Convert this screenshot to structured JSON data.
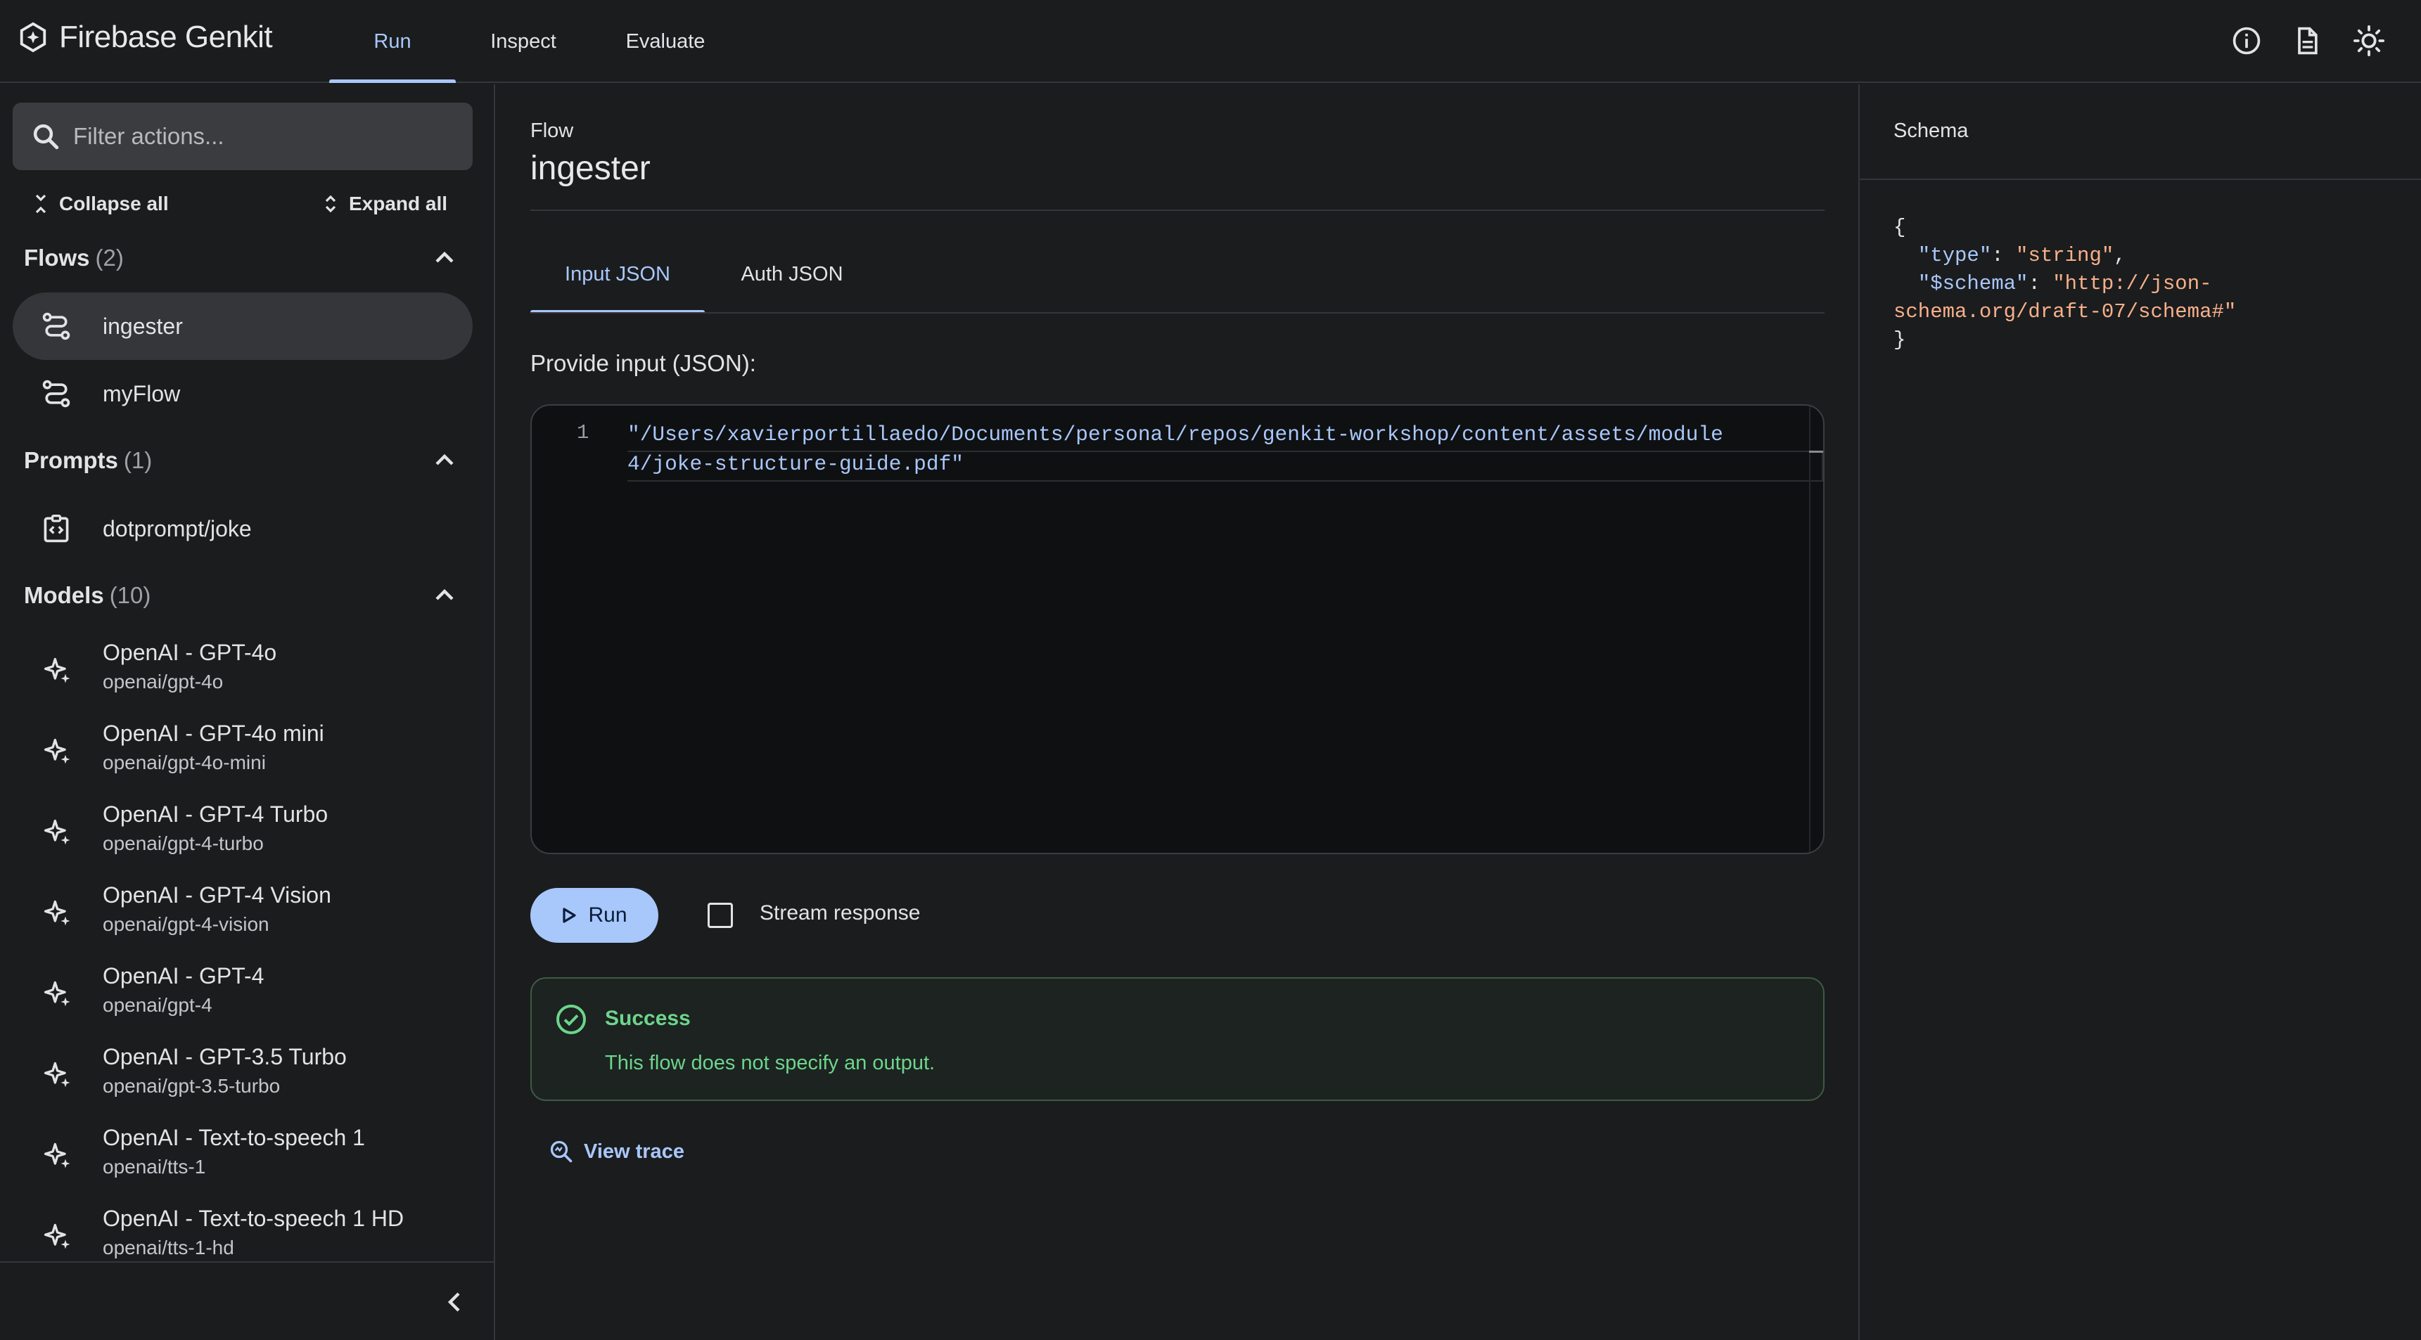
{
  "app": {
    "title": "Firebase Genkit"
  },
  "nav": {
    "tabs": [
      "Run",
      "Inspect",
      "Evaluate"
    ],
    "active": "Run"
  },
  "topIcons": [
    "info-icon",
    "docs-icon",
    "theme-icon"
  ],
  "sidebar": {
    "search_placeholder": "Filter actions...",
    "collapse_all": "Collapse all",
    "expand_all": "Expand all",
    "sections": {
      "flows": {
        "label": "Flows",
        "count": "(2)",
        "items": [
          "ingester",
          "myFlow"
        ]
      },
      "prompts": {
        "label": "Prompts",
        "count": "(1)",
        "items": [
          "dotprompt/joke"
        ]
      },
      "models": {
        "label": "Models",
        "count": "(10)",
        "items": [
          {
            "name": "OpenAI - GPT-4o",
            "id": "openai/gpt-4o"
          },
          {
            "name": "OpenAI - GPT-4o mini",
            "id": "openai/gpt-4o-mini"
          },
          {
            "name": "OpenAI - GPT-4 Turbo",
            "id": "openai/gpt-4-turbo"
          },
          {
            "name": "OpenAI - GPT-4 Vision",
            "id": "openai/gpt-4-vision"
          },
          {
            "name": "OpenAI - GPT-4",
            "id": "openai/gpt-4"
          },
          {
            "name": "OpenAI - GPT-3.5 Turbo",
            "id": "openai/gpt-3.5-turbo"
          },
          {
            "name": "OpenAI - Text-to-speech 1",
            "id": "openai/tts-1"
          },
          {
            "name": "OpenAI - Text-to-speech 1 HD",
            "id": "openai/tts-1-hd"
          }
        ]
      }
    },
    "selected": "ingester"
  },
  "main": {
    "kind": "Flow",
    "title": "ingester",
    "tabs": [
      "Input JSON",
      "Auth JSON"
    ],
    "active_tab": "Input JSON",
    "provide_label": "Provide input (JSON):",
    "editor": {
      "line_number": "1",
      "code": "\"/Users/xavierportillaedo/Documents/personal/repos/genkit-workshop/content/assets/module4/joke-structure-guide.pdf\""
    },
    "run_label": "Run",
    "stream_label": "Stream response",
    "stream_checked": false,
    "result": {
      "status": "Success",
      "message": "This flow does not specify an output."
    },
    "view_trace": "View trace"
  },
  "schema": {
    "title": "Schema",
    "open": "{",
    "type_key": "\"type\"",
    "type_value": "\"string\"",
    "schema_key": "\"$schema\"",
    "schema_value_1": "\"http://json-",
    "schema_value_2": "schema.org/draft-07/schema#\"",
    "close": "}"
  },
  "colors": {
    "accent": "#a8c7fa",
    "success": "#6dd58c",
    "background": "#1b1c1e"
  }
}
